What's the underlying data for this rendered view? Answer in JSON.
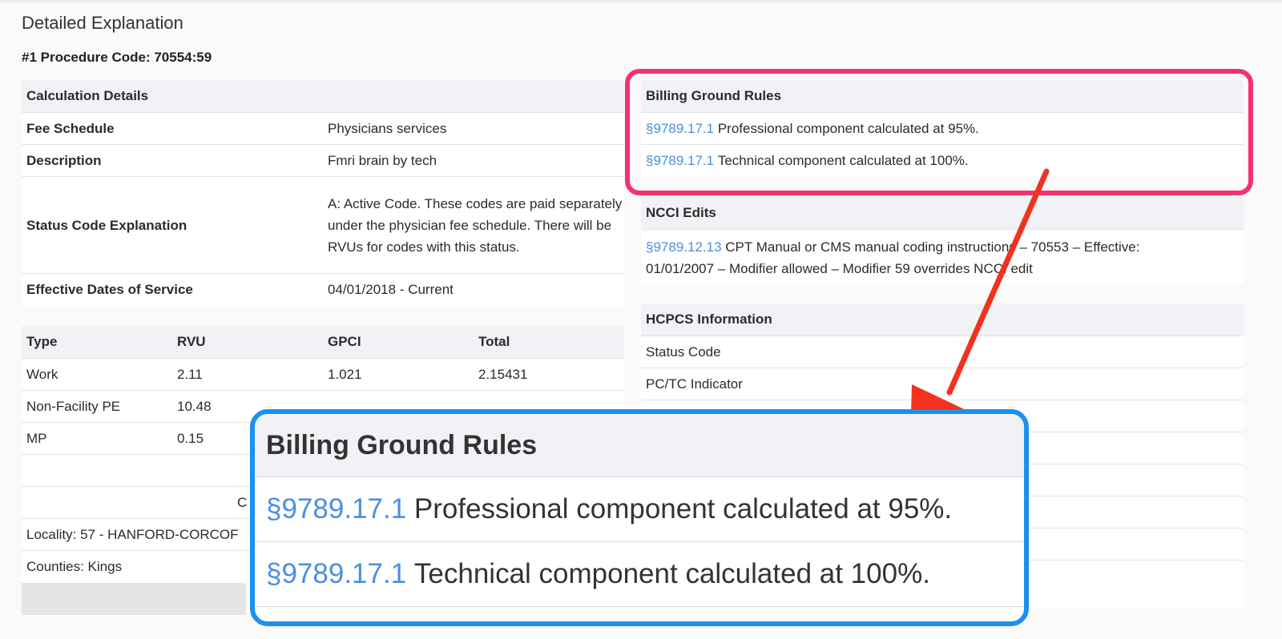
{
  "page": {
    "title": "Detailed Explanation",
    "procedure": "#1 Procedure Code: 70554:59"
  },
  "calc": {
    "header": "Calculation Details",
    "rows": [
      {
        "label": "Fee Schedule",
        "value": "Physicians services"
      },
      {
        "label": "Description",
        "value": "Fmri brain by tech"
      },
      {
        "label": "Status Code Explanation",
        "value": "A: Active Code. These codes are paid separately under the physician fee schedule. There will be RVUs for codes with this status."
      },
      {
        "label": "Effective Dates of Service",
        "value": "04/01/2018 - Current"
      }
    ]
  },
  "rvu": {
    "headers": [
      "Type",
      "RVU",
      "GPCI",
      "Total"
    ],
    "rows": [
      [
        "Work",
        "2.11",
        "1.021",
        "2.15431"
      ],
      [
        "Non-Facility PE",
        "10.48",
        "",
        ""
      ],
      [
        "MP",
        "0.15",
        "",
        ""
      ]
    ],
    "partial_c": "C",
    "locality": "Locality: 57 - HANFORD-CORCOF",
    "counties": "Counties: Kings"
  },
  "billing": {
    "header": "Billing Ground Rules",
    "rules": [
      {
        "ref": "§9789.17.1",
        "text": "Professional component calculated at 95%."
      },
      {
        "ref": "§9789.17.1",
        "text": "Technical component calculated at 100%."
      }
    ]
  },
  "ncci": {
    "header": "NCCI Edits",
    "ref": "§9789.12.13",
    "text_line1": "CPT Manual or CMS manual coding instructions – 70553 – Effective:",
    "text_line2": "01/01/2007 – Modifier allowed – Modifier 59 overrides NCCI edit"
  },
  "hcpcs": {
    "header": "HCPCS Information",
    "rows": [
      "Status Code",
      "PC/TC Indicator"
    ]
  },
  "colors": {
    "link": "#4a8fe0",
    "highlight_pink": "#f2326d",
    "zoom_border": "#1e90f0",
    "arrow": "#f0321e"
  }
}
